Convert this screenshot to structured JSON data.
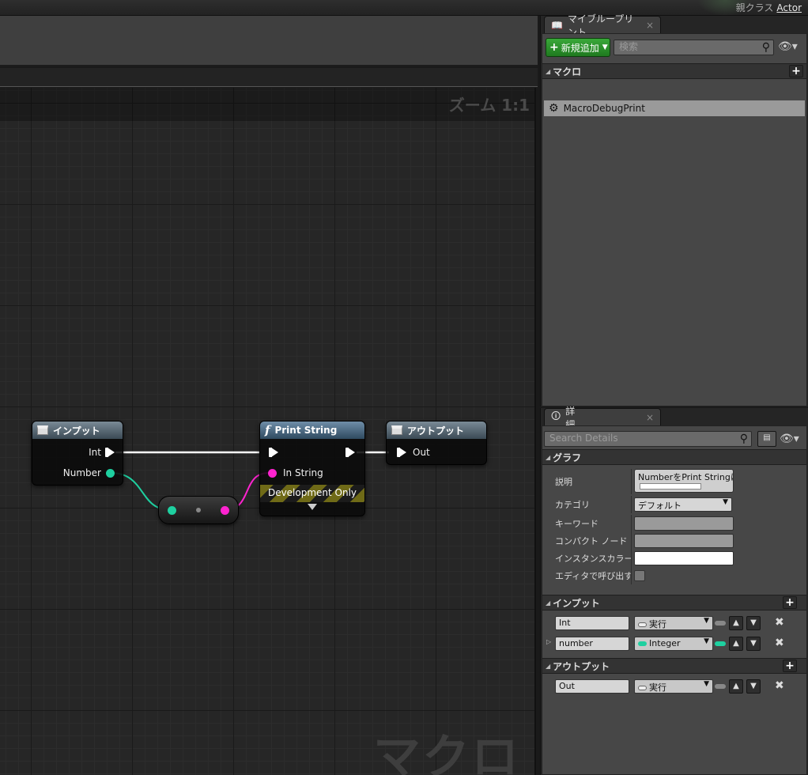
{
  "title_bar": {
    "parent_class_label": "親クラス",
    "parent_class_value": "Actor"
  },
  "graph": {
    "zoom_label": "ズーム 1:1",
    "watermark": "マクロ",
    "input_node": {
      "title": "インプット",
      "pins": [
        "Int",
        "Number"
      ]
    },
    "print_node": {
      "title": "Print String",
      "in_string_label": "In String",
      "dev_only_label": "Development Only"
    },
    "output_node": {
      "title": "アウトプット",
      "pin": "Out"
    }
  },
  "my_blueprint": {
    "tab_label": "マイブループリント",
    "add_new_label": "新規追加",
    "search_placeholder": "検索",
    "macro_category": "マクロ",
    "macro_item": "MacroDebugPrint"
  },
  "details": {
    "tab_label": "詳細",
    "search_placeholder": "Search Details",
    "graph_category": "グラフ",
    "props": {
      "description_label": "説明",
      "description_value": "NumberをPrint Stringに",
      "category_label": "カテゴリ",
      "category_value": "デフォルト",
      "keyword_label": "キーワード",
      "compact_label": "コンパクト ノード タ",
      "instance_color_label": "インスタンスカラー",
      "call_in_editor_label": "エディタで呼び出す"
    },
    "inputs_category": "インプット",
    "inputs": [
      {
        "name": "Int",
        "type": "実行"
      },
      {
        "name": "number",
        "type": "Integer"
      }
    ],
    "outputs_category": "アウトプット",
    "outputs": [
      {
        "name": "Out",
        "type": "実行"
      }
    ]
  },
  "colors": {
    "int_pin": "#1ed0a0",
    "string_pin": "#ff23d0",
    "add_button": "#2e8f2e"
  }
}
